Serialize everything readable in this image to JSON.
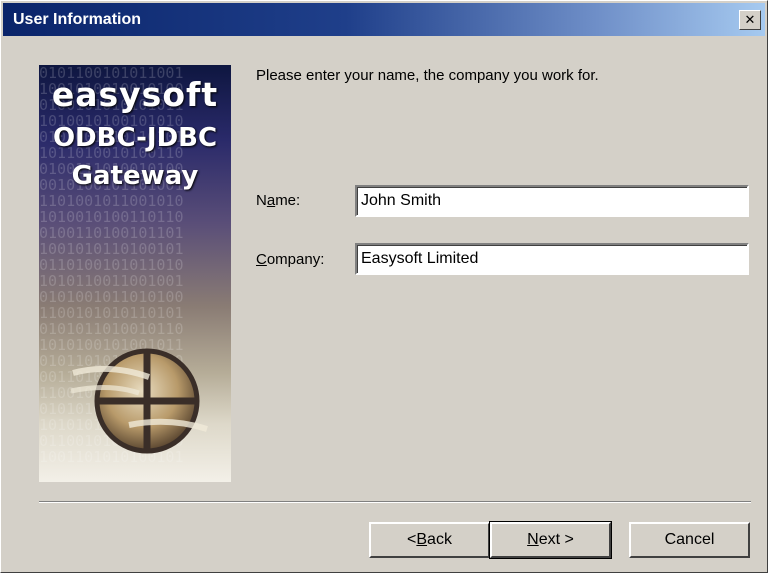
{
  "window": {
    "title": "User Information",
    "close_glyph": "✕"
  },
  "banner": {
    "brand_name": "easysoft",
    "product_line1": "ODBC-JDBC",
    "product_line2": "Gateway",
    "binary_pattern": "0101100101011001\n1001010010010100\n0100101010101011\n1010010100101010\n0101001110110101\n1011010010100110\n0100111010010100\n0010100101101001\n1101001011001010\n1010010100110110\n0100110100101101\n1001010110100101\n0110100101011010\n1010110011001001\n0101001011010100\n1100101010110101\n0101011010010110\n1010100101001011\n0101101010100110\n0011010110101001\n1100101001010110\n0101010010110101\n1010101101010010\n0110010101011010\n1001101010100101",
    "logo_icon": "easysoft-globe-logo"
  },
  "prompt": "Please enter your name, the company you work for.",
  "name": {
    "label_pre": "N",
    "label_key": "a",
    "label_post": "me:",
    "value": "John Smith"
  },
  "company": {
    "label_key": "C",
    "label_post": "ompany:",
    "value": "Easysoft Limited"
  },
  "buttons": {
    "back_pre": "< ",
    "back_key": "B",
    "back_post": "ack",
    "next_key": "N",
    "next_post": "ext >",
    "cancel": "Cancel"
  }
}
